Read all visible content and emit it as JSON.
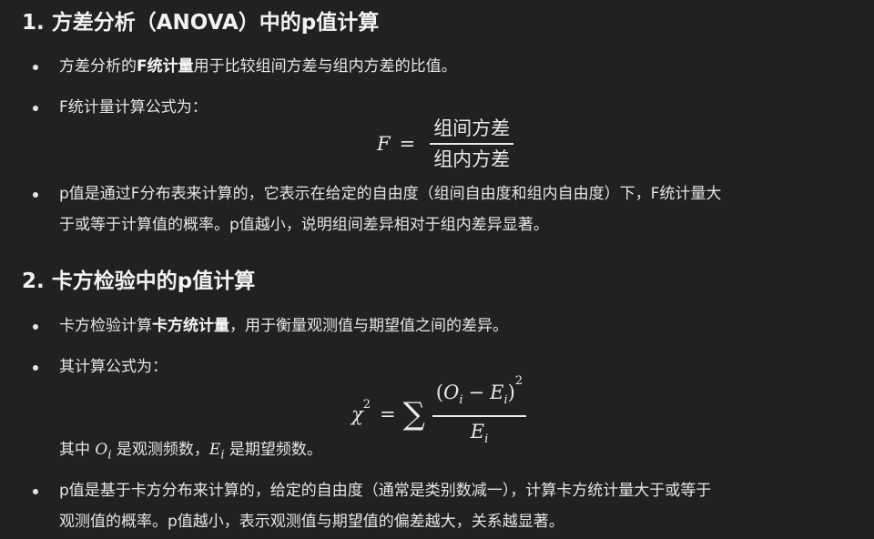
{
  "section1": {
    "heading": "1. 方差分析（ANOVA）中的p值计算",
    "bullet1": {
      "pre": "方差分析的",
      "bold": "F统计量",
      "post": "用于比较组间方差与组内方差的比值。"
    },
    "bullet2": {
      "text": "F统计量计算公式为："
    },
    "formula": {
      "lhs": "F",
      "eq": "=",
      "numerator": "组间方差",
      "denominator": "组内方差"
    },
    "bullet3": {
      "line1": "p值是通过F分布表来计算的，它表示在给定的自由度（组间自由度和组内自由度）下，F统计量大",
      "line2": "于或等于计算值的概率。p值越小，说明组间差异相对于组内差异显著。"
    }
  },
  "section2": {
    "heading": "2. 卡方检验中的p值计算",
    "bullet1": {
      "pre": "卡方检验计算",
      "bold": "卡方统计量",
      "post": "，用于衡量观测值与期望值之间的差异。"
    },
    "bullet2": {
      "text": "其计算公式为："
    },
    "formula": {
      "chi": "χ",
      "power": "2",
      "eq": "=",
      "sum": "∑",
      "num_open": "(",
      "O": "O",
      "i1": "i",
      "minus": "−",
      "E": "E",
      "i2": "i",
      "num_close": ")",
      "num_power": "2",
      "den_E": "E",
      "den_i": "i"
    },
    "where": {
      "pre": "其中",
      "O": "O",
      "Oi": "i",
      "mid": "是观测频数，",
      "E": "E",
      "Ei": "i",
      "post": "是期望频数。"
    },
    "bullet3": {
      "line1": "p值是基于卡方分布来计算的，给定的自由度（通常是类别数减一），计算卡方统计量大于或等于",
      "line2": "观测值的概率。p值越小，表示观测值与期望值的偏差越大，关系越显著。"
    }
  }
}
